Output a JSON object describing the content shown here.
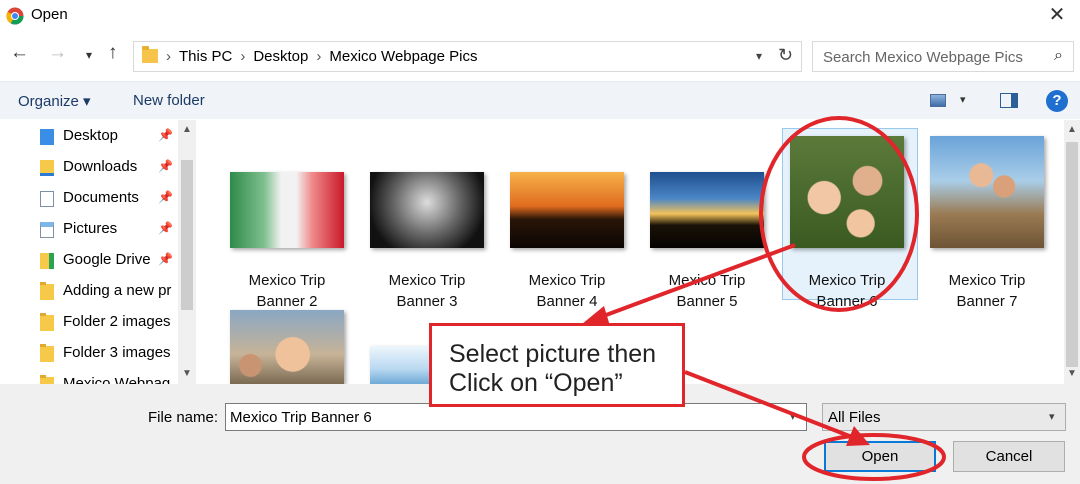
{
  "window": {
    "title": "Open",
    "app_icon": "chrome-icon",
    "close_glyph": "✕"
  },
  "nav": {
    "back": "←",
    "forward": "→",
    "recent": "⌄",
    "up": "↑"
  },
  "address": {
    "crumbs": [
      "This PC",
      "Desktop",
      "Mexico Webpage Pics"
    ],
    "refresh": "↻",
    "chevron": "⌄"
  },
  "search": {
    "placeholder": "Search Mexico Webpage Pics",
    "icon": "⌕"
  },
  "toolbar": {
    "organize": "Organize ▾",
    "new_folder": "New folder",
    "view_dropdown": "▾",
    "help": "?"
  },
  "sidebar": {
    "items": [
      {
        "label": "Desktop",
        "pinned": true
      },
      {
        "label": "Downloads",
        "pinned": true
      },
      {
        "label": "Documents",
        "pinned": true
      },
      {
        "label": "Pictures",
        "pinned": true
      },
      {
        "label": "Google Drive",
        "pinned": true
      },
      {
        "label": "Adding a new pr",
        "pinned": false
      },
      {
        "label": "Folder 2 images",
        "pinned": false
      },
      {
        "label": "Folder 3 images",
        "pinned": false
      },
      {
        "label": "Mexico Webpag",
        "pinned": false
      }
    ],
    "pin_glyph": "📌"
  },
  "files": [
    {
      "line1": "Mexico Trip",
      "line2": "Banner 2"
    },
    {
      "line1": "Mexico Trip",
      "line2": "Banner 3"
    },
    {
      "line1": "Mexico Trip",
      "line2": "Banner 4"
    },
    {
      "line1": "Mexico Trip",
      "line2": "Banner 5"
    },
    {
      "line1": "Mexico Trip",
      "line2": "Banner 6"
    },
    {
      "line1": "Mexico Trip",
      "line2": "Banner 7"
    }
  ],
  "bottom": {
    "file_name_label": "File name:",
    "file_name_value": "Mexico Trip Banner 6",
    "file_type": "All Files",
    "open_button": "Open",
    "cancel_button": "Cancel"
  },
  "annotation": {
    "text": "Select picture then\nClick on “Open”",
    "color": "#e0252b"
  }
}
